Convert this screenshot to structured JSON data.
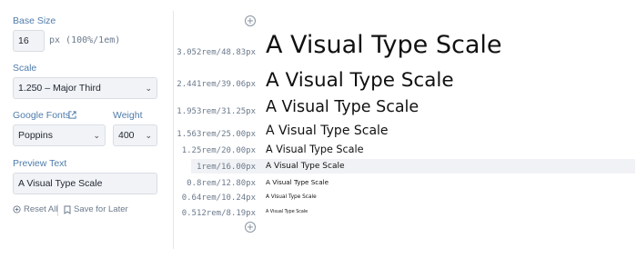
{
  "sidebar": {
    "base_size": {
      "label": "Base Size",
      "value": "16",
      "unit": "px (100%/1em)"
    },
    "scale": {
      "label": "Scale",
      "selected": "1.250 – Major Third"
    },
    "google_fonts": {
      "label": "Google Fonts",
      "selected": "Poppins"
    },
    "weight": {
      "label": "Weight",
      "selected": "400"
    },
    "preview_text": {
      "label": "Preview Text",
      "value": "A Visual Type Scale"
    },
    "actions": {
      "reset": "Reset All",
      "save": "Save for Later"
    }
  },
  "preview": {
    "rows": [
      {
        "size": "3.052rem/48.83px",
        "text": "A Visual Type Scale"
      },
      {
        "size": "2.441rem/39.06px",
        "text": "A Visual Type Scale"
      },
      {
        "size": "1.953rem/31.25px",
        "text": "A Visual Type Scale"
      },
      {
        "size": "1.563rem/25.00px",
        "text": "A Visual Type Scale"
      },
      {
        "size": "1.25rem/20.00px",
        "text": "A Visual Type Scale"
      },
      {
        "size": "1rem/16.00px",
        "text": "A Visual Type Scale"
      },
      {
        "size": "0.8rem/12.80px",
        "text": "A Visual Type Scale"
      },
      {
        "size": "0.64rem/10.24px",
        "text": "A Visual Type Scale"
      },
      {
        "size": "0.512rem/8.19px",
        "text": "A Visual Type Scale"
      }
    ]
  },
  "colors": {
    "label": "#4f7cab",
    "input_bg": "#f1f3f6",
    "highlight": "#f0f2f5"
  }
}
